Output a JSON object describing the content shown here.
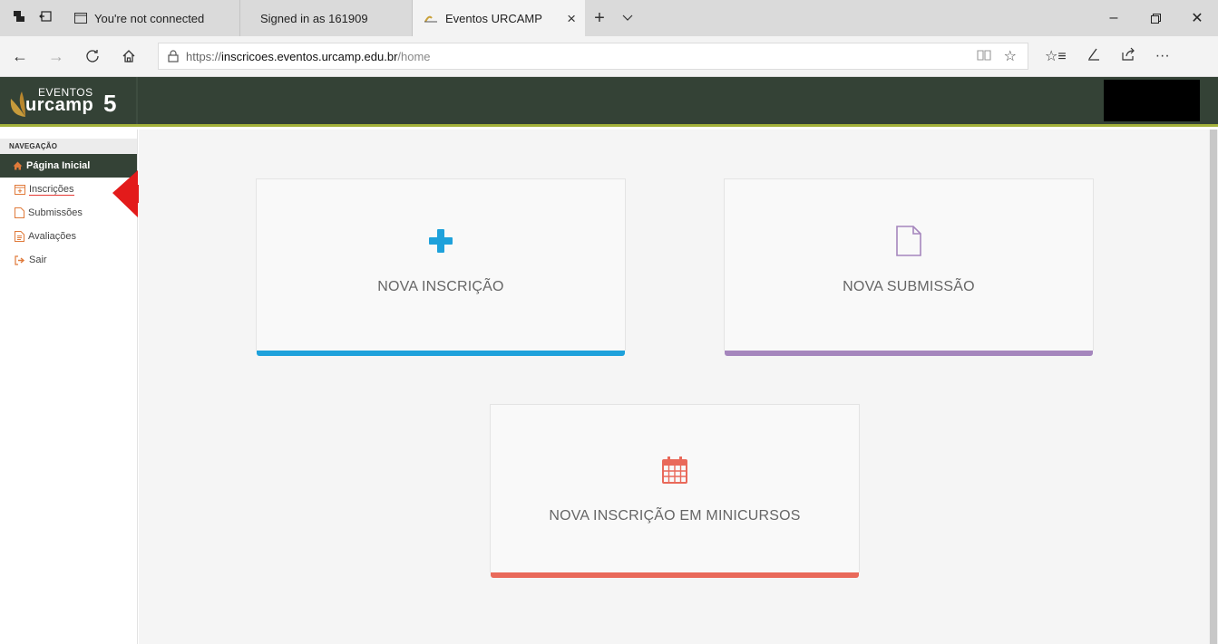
{
  "browser": {
    "tabs": [
      {
        "title": "You're not connected"
      },
      {
        "title": "Signed in as 161909"
      },
      {
        "title": "Eventos URCAMP",
        "active": true
      }
    ],
    "url": {
      "protocol": "https://",
      "host": "inscricoes.eventos.urcamp.edu.br",
      "path": "/home"
    }
  },
  "site": {
    "logo": {
      "top": "EVENTOS",
      "main": "urcamp",
      "number": "5"
    }
  },
  "sidebar": {
    "heading": "NAVEGAÇÃO",
    "items": [
      {
        "label": "Página Inicial",
        "icon": "home-icon",
        "active": true
      },
      {
        "label": "Inscrições",
        "icon": "calendar-icon"
      },
      {
        "label": "Submissões",
        "icon": "file-icon"
      },
      {
        "label": "Avaliações",
        "icon": "document-icon"
      },
      {
        "label": "Sair",
        "icon": "sign-out-icon"
      }
    ]
  },
  "cards": [
    {
      "title": "NOVA INSCRIÇÃO",
      "icon": "plus-icon",
      "color": "#1ea1db"
    },
    {
      "title": "NOVA SUBMISSÃO",
      "icon": "file-icon",
      "color": "#a586bd"
    },
    {
      "title": "NOVA INSCRIÇÃO EM MINICURSOS",
      "icon": "calendar-icon",
      "color": "#e9695a"
    }
  ],
  "colors": {
    "header_bg": "#344236",
    "header_accent": "#a3b13a",
    "annotation_arrow": "#e31b1b"
  }
}
